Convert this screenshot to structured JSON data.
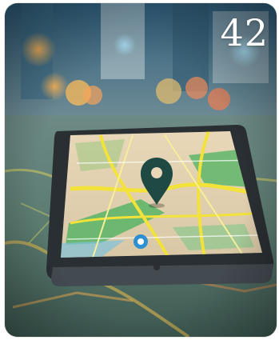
{
  "badge": {
    "number": "42"
  },
  "image": {
    "subject": "smartphone-with-map-location-pin",
    "pin_color": "#1f4a44",
    "map_road_color": "#f2e23a",
    "map_park_color": "#5fb66a",
    "bokeh_colors": [
      "#f4a14a",
      "#f07a3a",
      "#e8c266",
      "#8fd0ee",
      "#f08a72"
    ]
  }
}
